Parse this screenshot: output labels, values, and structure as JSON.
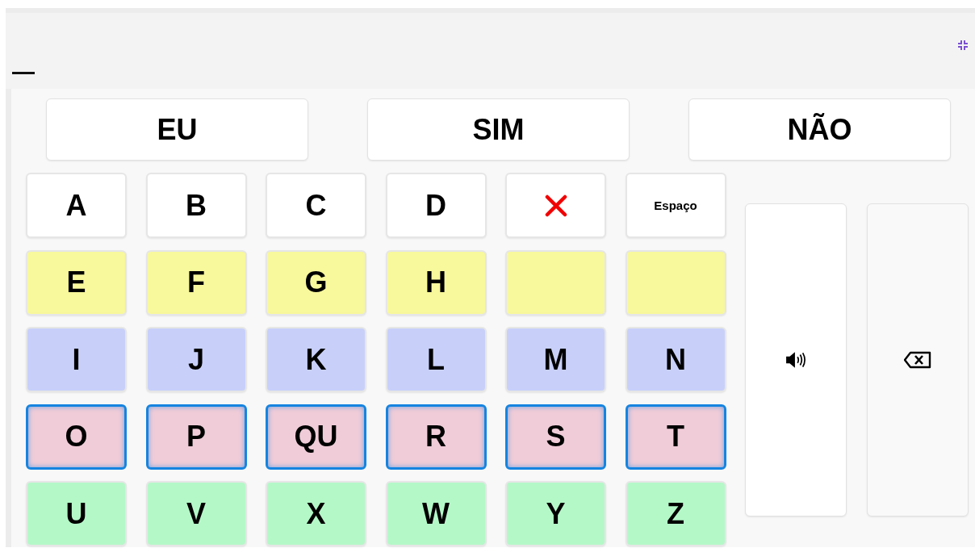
{
  "text_field": {
    "cursor": true
  },
  "phrases": [
    "EU",
    "SIM",
    "NÃO"
  ],
  "rows": [
    {
      "color": "#ffffff",
      "selected": false,
      "keys": [
        {
          "kind": "letter",
          "label": "A"
        },
        {
          "kind": "letter",
          "label": "B"
        },
        {
          "kind": "letter",
          "label": "C"
        },
        {
          "kind": "letter",
          "label": "D"
        },
        {
          "kind": "clear"
        },
        {
          "kind": "word",
          "label": "Espaço"
        }
      ]
    },
    {
      "color": "#f8f89c",
      "selected": false,
      "keys": [
        {
          "kind": "letter",
          "label": "E"
        },
        {
          "kind": "letter",
          "label": "F"
        },
        {
          "kind": "letter",
          "label": "G"
        },
        {
          "kind": "letter",
          "label": "H"
        },
        {
          "kind": "blank"
        },
        {
          "kind": "blank"
        }
      ]
    },
    {
      "color": "#c8d0fa",
      "selected": false,
      "keys": [
        {
          "kind": "letter",
          "label": "I"
        },
        {
          "kind": "letter",
          "label": "J"
        },
        {
          "kind": "letter",
          "label": "K"
        },
        {
          "kind": "letter",
          "label": "L"
        },
        {
          "kind": "letter",
          "label": "M"
        },
        {
          "kind": "letter",
          "label": "N"
        }
      ]
    },
    {
      "color": "#f0ccd8",
      "selected": true,
      "keys": [
        {
          "kind": "letter",
          "label": "O"
        },
        {
          "kind": "letter",
          "label": "P"
        },
        {
          "kind": "letter",
          "label": "QU"
        },
        {
          "kind": "letter",
          "label": "R"
        },
        {
          "kind": "letter",
          "label": "S"
        },
        {
          "kind": "letter",
          "label": "T"
        }
      ]
    },
    {
      "color": "#b4f8c8",
      "selected": false,
      "keys": [
        {
          "kind": "letter",
          "label": "U"
        },
        {
          "kind": "letter",
          "label": "V"
        },
        {
          "kind": "letter",
          "label": "X"
        },
        {
          "kind": "letter",
          "label": "W"
        },
        {
          "kind": "letter",
          "label": "Y"
        },
        {
          "kind": "letter",
          "label": "Z"
        }
      ]
    }
  ],
  "side_buttons": [
    {
      "kind": "speak"
    },
    {
      "kind": "backspace"
    }
  ]
}
